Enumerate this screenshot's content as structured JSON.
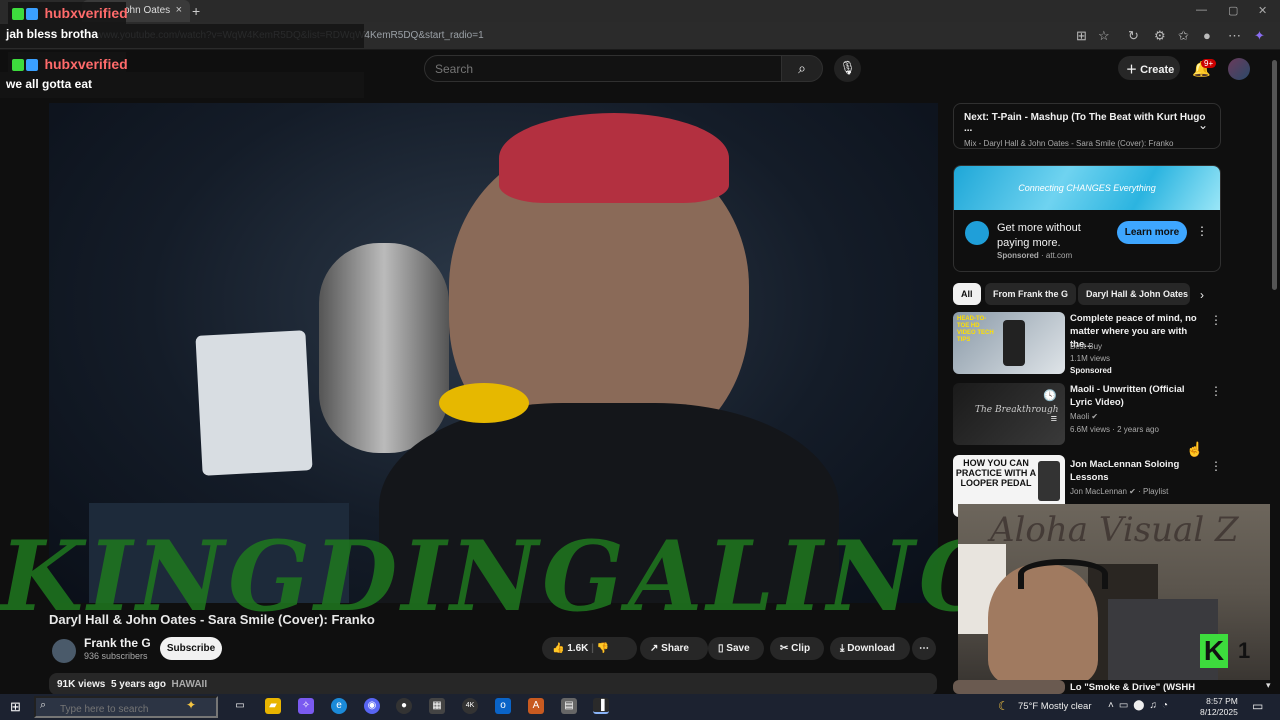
{
  "browser": {
    "tab_title": "ohn Oates",
    "url": "www.youtube.com/watch?v=WqW4KemR5DQ&list=RDWqW4KemR5DQ&start_radio=1",
    "new_tab": "+",
    "tab_close": "×"
  },
  "chat": [
    {
      "user": "hubxverified",
      "message": "jah bless brotha"
    },
    {
      "user": "hubxverified",
      "message": "we all gotta eat"
    }
  ],
  "header": {
    "search_placeholder": "Search",
    "create_label": "Create",
    "notifications_count": "9+"
  },
  "video": {
    "watermark": "KINGDINGALING  FA",
    "title": "Daryl Hall & John Oates - Sara Smile (Cover): Franko",
    "channel": "Frank the G",
    "subscribers": "936 subscribers",
    "subscribe_label": "Subscribe",
    "likes": "1.6K",
    "share_label": "Share",
    "save_label": "Save",
    "clip_label": "Clip",
    "download_label": "Download",
    "views": "91K views",
    "age": "5 years ago",
    "tag": "HAWAII"
  },
  "up_next": {
    "title": "Next: T-Pain - Mashup (To The Beat with Kurt Hugo ...",
    "subtitle": "Mix - Daryl Hall & John Oates - Sara Smile (Cover): Franko"
  },
  "ad": {
    "banner_text": "Connecting CHANGES Everything",
    "title": "Get more without paying more.",
    "sponsored": "Sponsored",
    "domain": "att.com",
    "cta": "Learn more"
  },
  "chips": [
    "All",
    "From Frank the G",
    "Daryl Hall & John Oates"
  ],
  "recommendations": [
    {
      "title": "Complete peace of mind, no matter where you are with the...",
      "channel": "Best Buy",
      "meta": "1.1M views",
      "extra": "Sponsored",
      "thumb_text": "HEAD-TO-TOE HD VIDEO TECH TIPS"
    },
    {
      "title": "Maoli - Unwritten (Official Lyric Video)",
      "channel": "Maoli",
      "meta": "6.6M views · 2 years ago",
      "extra": "",
      "thumb_text": "The Breakthrough"
    },
    {
      "title": "Jon MacLennan Soloing Lessons",
      "channel": "Jon MacLennan",
      "meta": "Playlist",
      "extra": "",
      "thumb_text": "HOW YOU CAN PRACTICE WITH A LOOPER PEDAL"
    },
    {
      "title": "Lo \"Smoke & Drive\" (WSHH ...",
      "channel": "",
      "meta": "",
      "extra": "",
      "thumb_text": ""
    }
  ],
  "webcam": {
    "overlay_text": "Aloha Visual Z",
    "counter": "1"
  },
  "taskbar": {
    "search_placeholder": "Type here to search",
    "weather": "75°F  Mostly clear",
    "time": "8:57 PM",
    "date": "8/12/2025"
  }
}
